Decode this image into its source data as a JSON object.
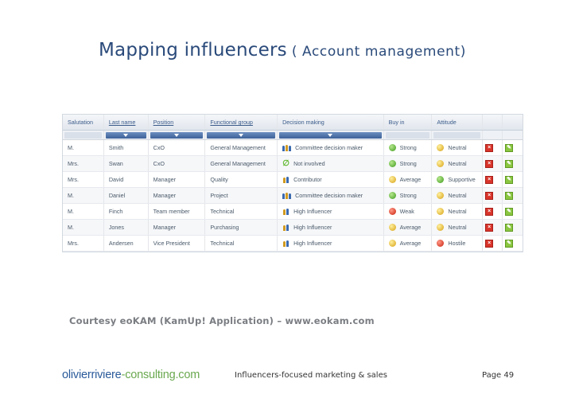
{
  "slide": {
    "title_main": "Mapping influencers",
    "title_sub": "( Account management)",
    "courtesy": "Courtesy eoKAM (KamUp! Application) – www.eokam.com",
    "footer_logo_part1": "olivierriviere",
    "footer_logo_part2": "-consulting.com",
    "footer_center": "Influencers-focused marketing & sales",
    "footer_page": "Page  49"
  },
  "grid": {
    "headers": [
      "Salutation",
      "Last name",
      "Position",
      "Functional group",
      "Decision making",
      "Buy in",
      "Attitude"
    ],
    "rows": [
      {
        "salutation": "M.",
        "last_name": "Smith",
        "position": "CxO",
        "group": "General Management",
        "decision": "Committee decision maker",
        "decision_icon": "committee-icon",
        "buyin": "Strong",
        "buyin_color": "green",
        "attitude": "Neutral",
        "attitude_color": "yellow"
      },
      {
        "salutation": "Mrs.",
        "last_name": "Swan",
        "position": "CxO",
        "group": "General Management",
        "decision": "Not involved",
        "decision_icon": "not-involved-icon",
        "buyin": "Strong",
        "buyin_color": "green",
        "attitude": "Neutral",
        "attitude_color": "yellow"
      },
      {
        "salutation": "Mrs.",
        "last_name": "David",
        "position": "Manager",
        "group": "Quality",
        "decision": "Contributor",
        "decision_icon": "contributor-icon",
        "buyin": "Average",
        "buyin_color": "yellow",
        "attitude": "Supportive",
        "attitude_color": "green"
      },
      {
        "salutation": "M.",
        "last_name": "Daniel",
        "position": "Manager",
        "group": "Project",
        "decision": "Committee decision maker",
        "decision_icon": "committee-icon",
        "buyin": "Strong",
        "buyin_color": "green",
        "attitude": "Neutral",
        "attitude_color": "yellow"
      },
      {
        "salutation": "M.",
        "last_name": "Finch",
        "position": "Team member",
        "group": "Technical",
        "decision": "High Influencer",
        "decision_icon": "high-influencer-icon",
        "buyin": "Weak",
        "buyin_color": "red",
        "attitude": "Neutral",
        "attitude_color": "yellow"
      },
      {
        "salutation": "M.",
        "last_name": "Jones",
        "position": "Manager",
        "group": "Purchasing",
        "decision": "High Influencer",
        "decision_icon": "high-influencer-icon",
        "buyin": "Average",
        "buyin_color": "yellow",
        "attitude": "Neutral",
        "attitude_color": "yellow"
      },
      {
        "salutation": "Mrs.",
        "last_name": "Andersen",
        "position": "Vice President",
        "group": "Technical",
        "decision": "High Influencer",
        "decision_icon": "high-influencer-icon",
        "buyin": "Average",
        "buyin_color": "yellow",
        "attitude": "Hostile",
        "attitude_color": "red"
      }
    ]
  },
  "colors": {
    "green": "#3d9a1a",
    "yellow": "#d6a010",
    "red": "#c8200a",
    "title": "#2a4a7a",
    "header_link": "#3b5b8a"
  }
}
